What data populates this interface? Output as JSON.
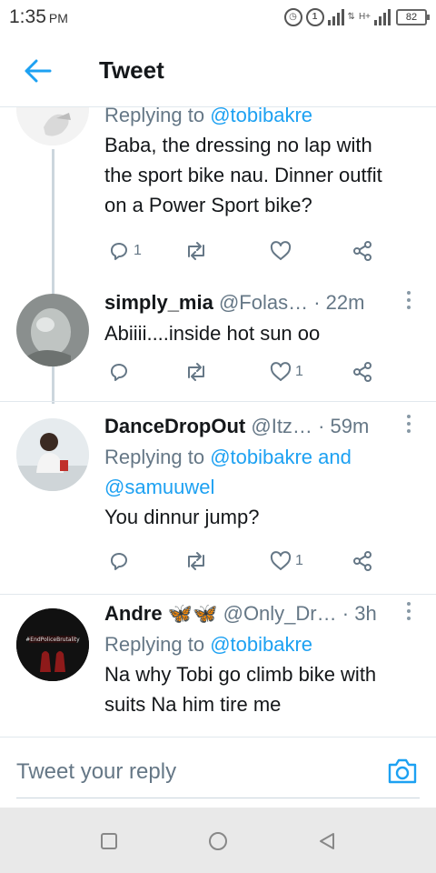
{
  "status_bar": {
    "time": "1:35",
    "ampm": "PM",
    "sim_indicator": "1",
    "network": "H+",
    "battery": "82"
  },
  "header": {
    "title": "Tweet",
    "back_icon": "arrow-left-icon"
  },
  "tweets": [
    {
      "replying_prefix": "Replying to",
      "replying_to": "@tobibakre",
      "text_lines": [
        "Baba, the dressing no lap with",
        "the sport bike nau. Dinner outfit",
        "on a Power Sport bike?"
      ],
      "reply_count": "1",
      "retweet_count": "",
      "like_count": ""
    },
    {
      "name": "simply_mia",
      "handle": "@Folas…",
      "time": "· 22m",
      "text_lines": [
        "Abiiii....inside hot sun oo"
      ],
      "reply_count": "",
      "retweet_count": "",
      "like_count": "1"
    },
    {
      "name": "DanceDropOut",
      "handle": "@Itz…",
      "time": "· 59m",
      "replying_prefix": "Replying to",
      "replying_lines": [
        "@tobibakre and",
        "@samuuwel"
      ],
      "text_lines": [
        "You dinnur jump?"
      ],
      "reply_count": "",
      "retweet_count": "",
      "like_count": "1"
    },
    {
      "name": "Andre",
      "emoji": "🦋🦋",
      "handle": "@Only_Dr…",
      "time": "· 3h",
      "replying_prefix": "Replying to",
      "replying_to": "@tobibakre",
      "avatar_text": "#EndPoliceBrutality",
      "text_lines": [
        "Na why Tobi go climb bike with",
        "suits Na him tire me"
      ]
    }
  ],
  "compose": {
    "placeholder": "Tweet your reply",
    "camera_icon": "camera-icon"
  },
  "navbar": {
    "icons": [
      "recents-square-icon",
      "home-circle-icon",
      "back-triangle-icon"
    ]
  },
  "colors": {
    "accent": "#1da1f2",
    "secondary_text": "#657786",
    "divider": "#e1e8ed",
    "butterfly": "#e8891c"
  }
}
